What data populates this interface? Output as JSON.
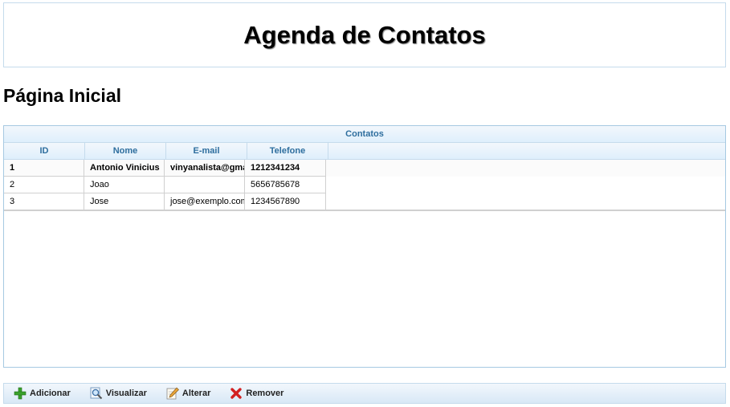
{
  "app": {
    "title": "Agenda de Contatos"
  },
  "page": {
    "title": "Página Inicial"
  },
  "grid": {
    "caption": "Contatos",
    "columns": [
      "ID",
      "Nome",
      "E-mail",
      "Telefone"
    ],
    "rows": [
      {
        "id": "1",
        "nome": "Antonio Vinicius",
        "email": "vinyanalista@gmail.com",
        "telefone": "1212341234"
      },
      {
        "id": "2",
        "nome": "Joao",
        "email": "",
        "telefone": "5656785678"
      },
      {
        "id": "3",
        "nome": "Jose",
        "email": "jose@exemplo.com",
        "telefone": "1234567890"
      }
    ],
    "selected_row": 0
  },
  "toolbar": {
    "add_label": "Adicionar",
    "add_icon": "plus-icon",
    "view_label": "Visualizar",
    "view_icon": "magnifier-icon",
    "edit_label": "Alterar",
    "edit_icon": "pencil-icon",
    "remove_label": "Remover",
    "remove_icon": "delete-x-icon"
  },
  "colors": {
    "header_text": "#2e6e9e",
    "border": "#c5dbec",
    "add_green": "#3aa12c",
    "remove_red": "#d22020"
  }
}
